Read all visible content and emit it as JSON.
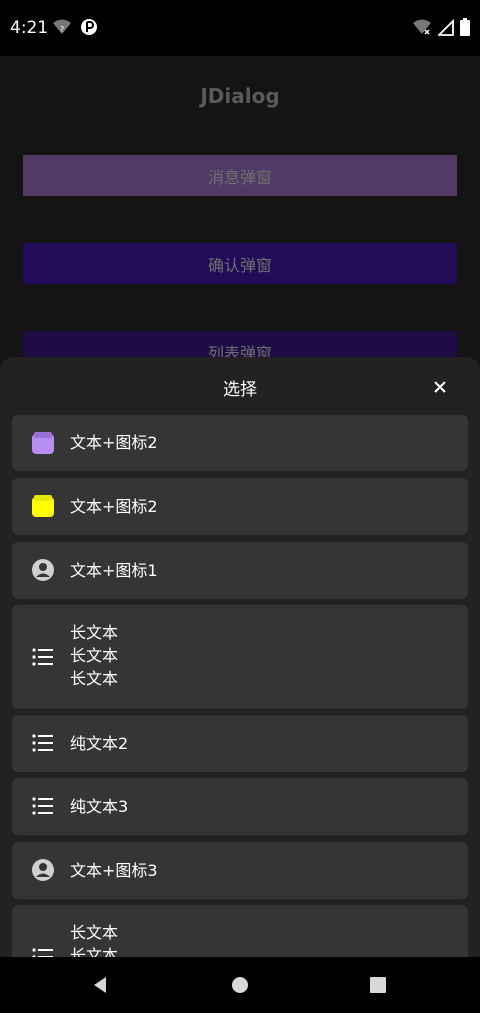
{
  "status_bar": {
    "time": "4:21"
  },
  "app": {
    "title": "JDialog",
    "buttons": [
      "消息弹窗",
      "确认弹窗",
      "列表弹窗"
    ]
  },
  "sheet": {
    "title": "选择",
    "items": [
      {
        "icon": "purple-box-icon",
        "label": "文本+图标2"
      },
      {
        "icon": "yellow-box-icon",
        "label": "文本+图标2"
      },
      {
        "icon": "account-circle-icon",
        "label": "文本+图标1"
      },
      {
        "icon": "list-icon",
        "label": "长文本\n长文本\n长文本"
      },
      {
        "icon": "list-icon",
        "label": "纯文本2"
      },
      {
        "icon": "list-icon",
        "label": "纯文本3"
      },
      {
        "icon": "account-circle-icon",
        "label": "文本+图标3"
      },
      {
        "icon": "list-icon",
        "label": "长文本\n长文本"
      }
    ]
  },
  "colors": {
    "purple_icon": "#b98cf2",
    "yellow_icon": "#ffff00"
  }
}
